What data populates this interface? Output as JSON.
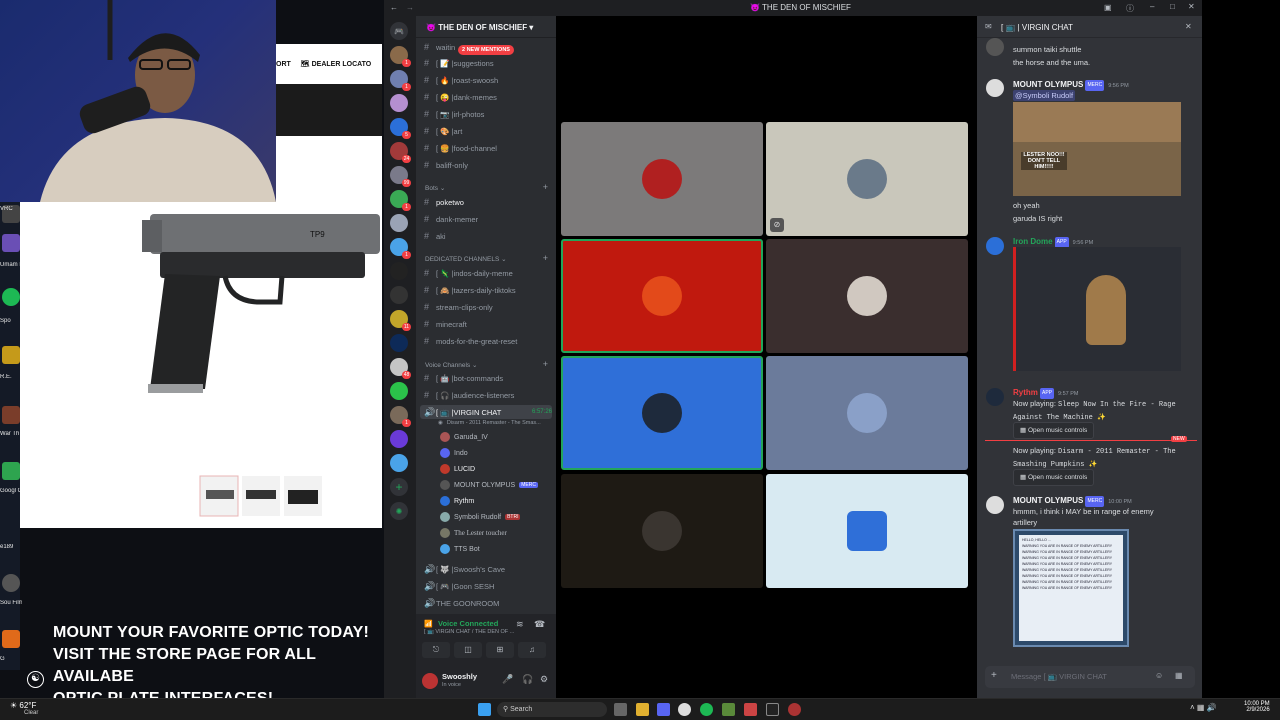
{
  "titlebar": {
    "title": "THE DEN OF MISCHIEF"
  },
  "stream": {
    "promo_lines": [
      "MOUNT YOUR FAVORITE OPTIC TODAY!",
      "VISIT THE STORE PAGE FOR ALL AVAILABE",
      "OPTIC PLATE INTERFACES!"
    ],
    "shop_nav": [
      "ORT",
      "DEALER LOCATO"
    ],
    "gun_label": "TP9",
    "desktop_labels": [
      "VRC",
      "Umam Pretty",
      "Spo",
      "R.E.",
      "War Th",
      "Googl Gam",
      "e189",
      "Sou Filmm",
      "G"
    ]
  },
  "server": {
    "name": "THE DEN OF MISCHIEF",
    "new_mentions": "2 NEW MENTIONS",
    "text_channels": [
      {
        "name": "waitin",
        "emoji": ""
      },
      {
        "name": "suggestions",
        "emoji": "[ 📝 | "
      },
      {
        "name": "roast-swoosh",
        "emoji": "[ 🔥 | "
      },
      {
        "name": "dank-memes",
        "emoji": "[ 😜 | "
      },
      {
        "name": "irl-photos",
        "emoji": "[ 📷 | "
      },
      {
        "name": "art",
        "emoji": "[ 🎨 | "
      },
      {
        "name": "food-channel",
        "emoji": "[ 🍔 | "
      },
      {
        "name": "baliff-only",
        "emoji": ""
      }
    ],
    "bots_category": "Bots",
    "bot_channels": [
      "poketwo",
      "dank-memer",
      "aki"
    ],
    "dedicated_category": "DEDICATED CHANNELS",
    "dedicated_channels": [
      {
        "name": "indos-daily-meme",
        "emoji": "[ 🦎 | "
      },
      {
        "name": "tazers-daily-tiktoks",
        "emoji": "[ 🙈 | "
      },
      {
        "name": "stream-clips-only",
        "emoji": ""
      },
      {
        "name": "minecraft",
        "emoji": ""
      },
      {
        "name": "mods-for-the-great-reset",
        "emoji": ""
      }
    ],
    "voice_category": "Voice Channels",
    "voice_channels": [
      {
        "name": "bot-commands",
        "emoji": "[ 🤖 | "
      },
      {
        "name": "audience-listeners",
        "emoji": "[ 🎧 | "
      }
    ],
    "active_voice": {
      "name": "VIRGIN CHAT",
      "emoji": "[ 📺 | ",
      "timer": "6:57:26",
      "activity": "Disarm - 2011 Remaster - The Smas..."
    },
    "voice_users": [
      "Garuda_IV",
      "Indo",
      "LUCID",
      "MOUNT OLYMPUS",
      "Rythm",
      "Symboli Rudolf",
      "The Lester toucher",
      "TTS Bot"
    ],
    "voice_user_tags": {
      "mount": "MERC",
      "symboli": "BTRI"
    },
    "other_voice": [
      {
        "name": "Swoosh's Cave",
        "emoji": "[ 🐺 | "
      },
      {
        "name": "Goon SESH",
        "emoji": "[ 🎮 | "
      },
      {
        "name": "THE GOONROOM",
        "emoji": ""
      }
    ],
    "voice_connected": "Voice Connected",
    "voice_connected_sub": "[ 📺 VIRGIN CHAT / THE DEN OF ...",
    "user": {
      "name": "Swooshly",
      "status": "In voice"
    }
  },
  "chat": {
    "channel": "[ 📺 | VIRGIN CHAT",
    "top_lines": [
      "summon taiki shuttle",
      "the horse and the uma."
    ],
    "messages": [
      {
        "author": "MOUNT OLYMPUS",
        "tag": "MERC",
        "time": "9:56 PM",
        "mention": "@Symboli Rudolf",
        "meme": "LESTER NOO!!! DON'T TELL HIM!!!!!",
        "lines": [
          "oh yeah",
          "garuda IS right"
        ]
      },
      {
        "author": "Iron Dome",
        "tag": "APP",
        "time": "9:56 PM"
      },
      {
        "author": "Rythm",
        "tag": "APP",
        "time": "9:57 PM",
        "now1": "Now playing:",
        "song1": "Sleep Now In the Fire - Rage Against The Machine ✨",
        "button": "Open music controls",
        "now2": "Now playing:",
        "song2": "Disarm - 2011 Remaster - The Smashing Pumpkins ✨",
        "new_label": "NEW"
      },
      {
        "author": "MOUNT OLYMPUS",
        "tag": "MERC",
        "time": "10:00 PM",
        "text": "hmmm, i think i MAY be in range of enemy artillery"
      }
    ],
    "warn_title": "HELLO, HELLO ...",
    "warn_text": "WARNING YOU ARE IN RANGE OF ENEMY ARTILLERY",
    "input_placeholder": "Message [ 📺 VIRGIN CHAT"
  },
  "taskbar": {
    "weather": "62°F",
    "weather_sub": "Clear",
    "search": "Search",
    "time": "10:00 PM",
    "date": "2/9/2026"
  },
  "colors": {
    "discord_bg": "#313338",
    "sidebar": "#2b2d31",
    "accent": "#5865f2",
    "danger": "#f23f43",
    "speaking": "#23a55a"
  }
}
